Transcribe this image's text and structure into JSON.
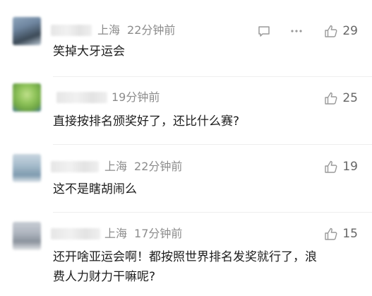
{
  "comments": [
    {
      "location": "上海",
      "time": "22分钟前",
      "text": "笑掉大牙运会",
      "likes": "29",
      "has_reply_more": true
    },
    {
      "location": "",
      "time": "19分钟前",
      "text": "直接按排名颁奖好了，还比什么赛?",
      "likes": "25",
      "has_reply_more": false
    },
    {
      "location": "上海",
      "time": "22分钟前",
      "text": "这不是瞎胡闹么",
      "likes": "19",
      "has_reply_more": false
    },
    {
      "location": "上海",
      "time": "17分钟前",
      "text_lines": [
        "还开啥亚运会啊！都按照世界排名发奖就行了，浪",
        "费人力财力干嘛呢?"
      ],
      "likes": "15",
      "has_reply_more": false
    }
  ],
  "icons": {
    "like": "thumbs-up-icon",
    "reply": "comment-icon",
    "more": "more-dots-icon"
  },
  "colors": {
    "meta": "#8c8c8c",
    "text": "#1d1d1d",
    "icon": "#9a9a9a"
  }
}
